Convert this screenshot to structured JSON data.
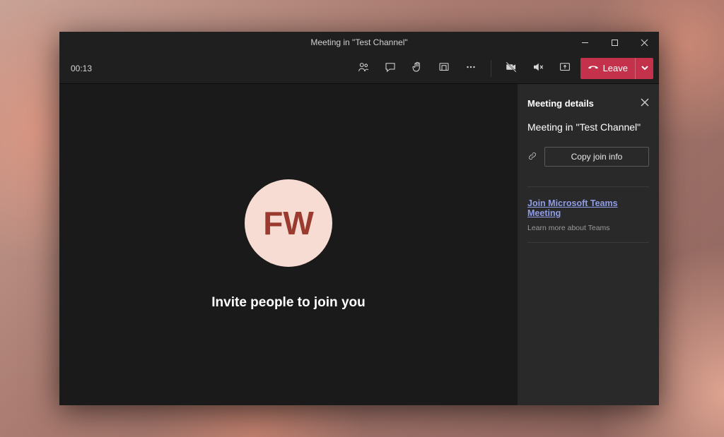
{
  "window": {
    "title": "Meeting in \"Test Channel\""
  },
  "toolbar": {
    "elapsed": "00:13",
    "leave_label": "Leave"
  },
  "stage": {
    "avatar_initials": "FW",
    "invite_text": "Invite people to join you"
  },
  "panel": {
    "header": "Meeting details",
    "meeting_name": "Meeting in \"Test Channel\"",
    "copy_label": "Copy join info",
    "join_link": "Join Microsoft Teams Meeting",
    "learn_more": "Learn more about Teams"
  }
}
